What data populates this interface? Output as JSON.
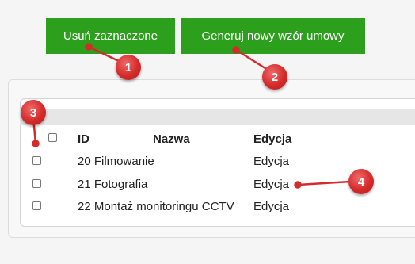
{
  "toolbar": {
    "delete_label": "Usuń zaznaczone",
    "generate_label": "Generuj nowy wzór umowy"
  },
  "table": {
    "headers": {
      "id": "ID",
      "name": "Nazwa",
      "edit": "Edycja"
    },
    "rows": [
      {
        "text": "20 Filmowanie",
        "edit": "Edycja"
      },
      {
        "text": "21 Fotografia",
        "edit": "Edycja"
      },
      {
        "text": "22 Montaż monitoringu CCTV",
        "edit": "Edycja"
      }
    ]
  },
  "annotations": [
    "1",
    "2",
    "3",
    "4"
  ],
  "colors": {
    "button": "#2ca01c",
    "annotation": "#d42a2a"
  }
}
